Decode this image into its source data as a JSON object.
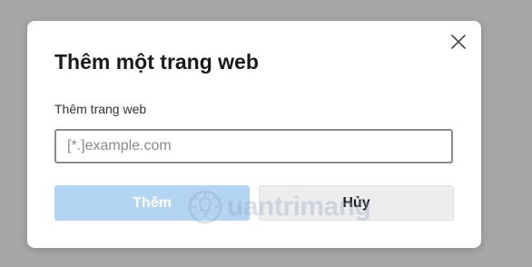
{
  "dialog": {
    "title": "Thêm một trang web",
    "field_label": "Thêm trang web",
    "input": {
      "value": "",
      "placeholder": "[*.]example.com"
    },
    "add_label": "Thêm",
    "cancel_label": "Hủy",
    "close_icon": "close-icon"
  },
  "watermark": {
    "text": "uantrimang",
    "icon": "lightbulb-logo-icon"
  },
  "colors": {
    "backdrop": "#a7a7a7",
    "dialog_bg": "#ffffff",
    "primary_disabled": "#b4d5f1",
    "secondary_bg": "#ededed",
    "input_border": "#8c8c8c"
  }
}
